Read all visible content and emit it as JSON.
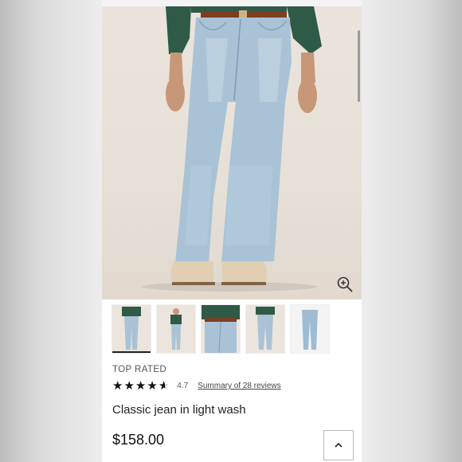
{
  "product": {
    "badge": "TOP RATED",
    "rating": "4.7",
    "reviews_link": "Summary of 28 reviews",
    "title": "Classic jean in light wash",
    "price": "$158.00"
  },
  "gallery": {
    "thumbnail_count": 5,
    "active_index": 0
  },
  "icons": {
    "zoom": "zoom-in-icon",
    "back_to_top": "chevron-up-icon",
    "star": "star-icon"
  },
  "colors": {
    "denim": "#a9c2d6",
    "sweater": "#2f5a48",
    "belt": "#7b3f22",
    "shoe": "#e0cfb3",
    "background": "#e8e1d8"
  }
}
